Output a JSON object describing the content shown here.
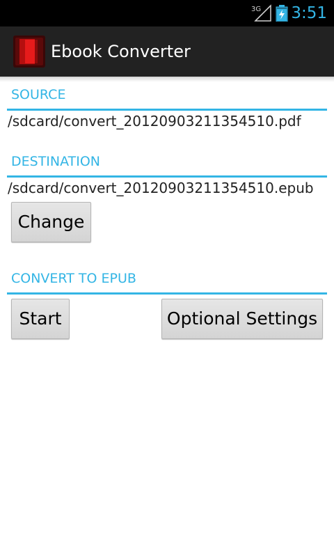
{
  "status_bar": {
    "network": "3G",
    "time": "3:51",
    "accent_color": "#33b5e5"
  },
  "action_bar": {
    "title": "Ebook Converter",
    "icon": "red-book-icon"
  },
  "source": {
    "header": "SOURCE",
    "path": "/sdcard/convert_20120903211354510.pdf"
  },
  "destination": {
    "header": "DESTINATION",
    "path": "/sdcard/convert_20120903211354510.epub",
    "change_label": "Change"
  },
  "convert": {
    "header": "CONVERT TO EPUB",
    "start_label": "Start",
    "settings_label": "Optional Settings"
  }
}
